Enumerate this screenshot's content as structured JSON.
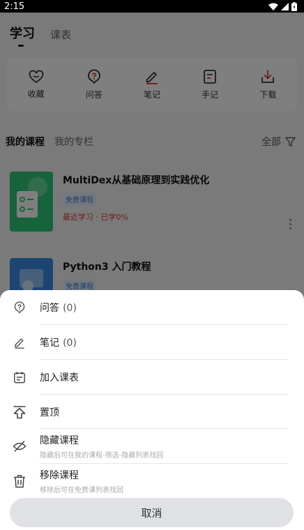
{
  "status_bar": {
    "time": "2:15"
  },
  "top_tabs": [
    {
      "label": "学习"
    },
    {
      "label": "课表"
    }
  ],
  "quick_actions": [
    {
      "icon": "heart-icon",
      "label": "收藏"
    },
    {
      "icon": "question-icon",
      "label": "问答"
    },
    {
      "icon": "pen-icon",
      "label": "笔记"
    },
    {
      "icon": "notebook-icon",
      "label": "手记"
    },
    {
      "icon": "download-icon",
      "label": "下载"
    }
  ],
  "course_tabs": {
    "my_courses": "我的课程",
    "my_columns": "我的专栏",
    "filter": "全部"
  },
  "courses": [
    {
      "title": "MultiDex从基础原理到实践优化",
      "tag": "免费课程",
      "progress": "最近学习 · 已学0%"
    },
    {
      "title": "Python3 入门教程",
      "tag": "免费课程"
    }
  ],
  "sheet": {
    "items": [
      {
        "icon": "question-icon",
        "label": "问答",
        "count": "(0)"
      },
      {
        "icon": "pen-icon",
        "label": "笔记",
        "count": "(0)"
      },
      {
        "icon": "calendar-icon",
        "label": "加入课表"
      },
      {
        "icon": "pin-top-icon",
        "label": "置顶"
      },
      {
        "icon": "eye-off-icon",
        "label": "隐藏课程",
        "sub": "隐藏后可在我的课程-筛选-隐藏列表找回"
      },
      {
        "icon": "trash-icon",
        "label": "移除课程",
        "sub": "移除后可在免费课列表找回"
      }
    ],
    "cancel": "取消"
  }
}
